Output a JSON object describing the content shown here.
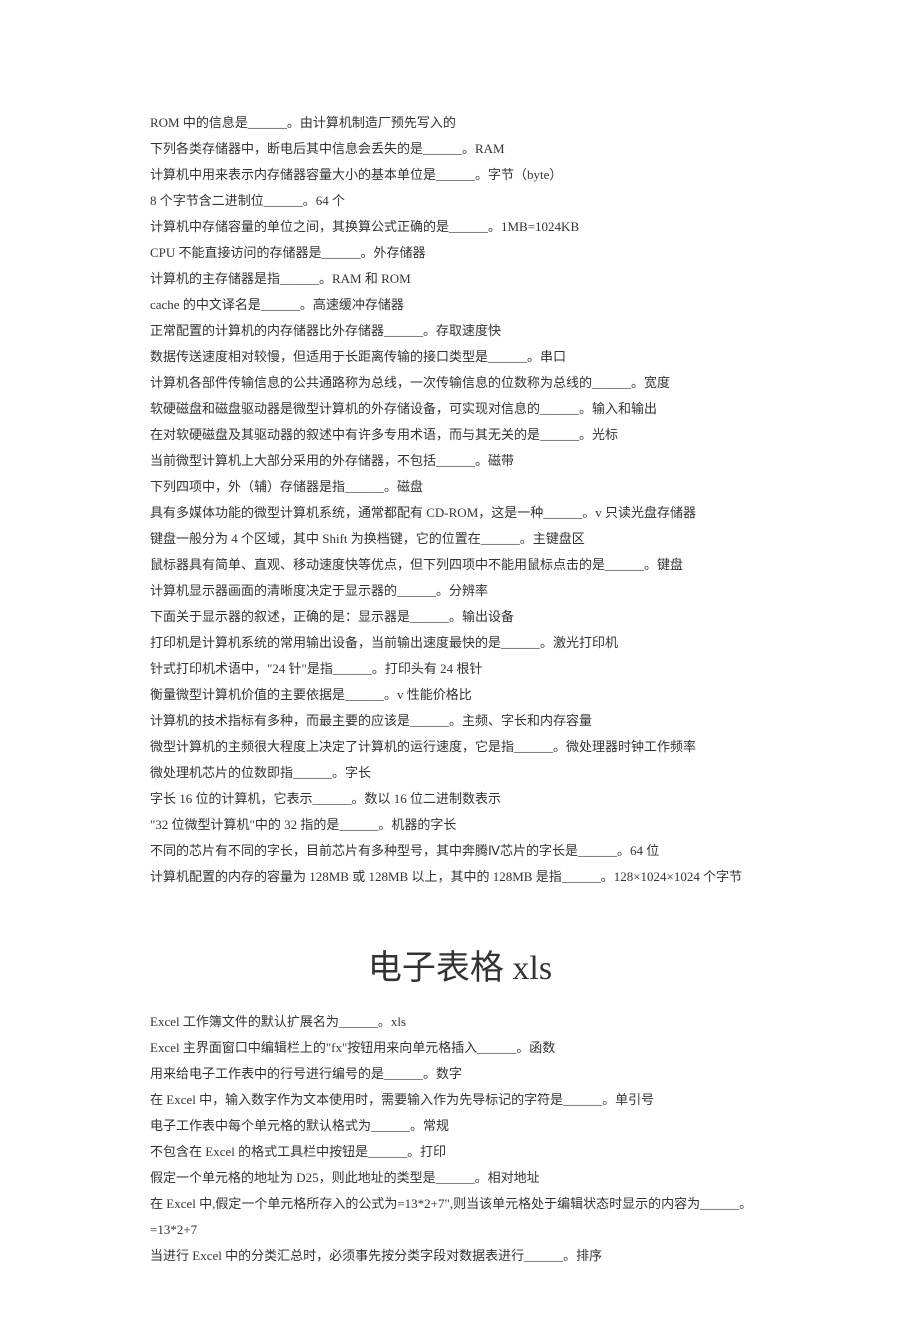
{
  "section1": {
    "lines": [
      "ROM 中的信息是______。由计算机制造厂预先写入的",
      "下列各类存储器中，断电后其中信息会丢失的是______。RAM",
      "计算机中用来表示内存储器容量大小的基本单位是______。字节（byte）",
      "8 个字节含二进制位______。64 个",
      "计算机中存储容量的单位之间，其换算公式正确的是______。1MB=1024KB",
      "CPU 不能直接访问的存储器是______。外存储器",
      "计算机的主存储器是指______。RAM 和 ROM",
      "cache 的中文译名是______。高速缓冲存储器",
      "正常配置的计算机的内存储器比外存储器______。存取速度快",
      "数据传送速度相对较慢，但适用于长距离传输的接口类型是______。串口",
      "计算机各部件传输信息的公共通路称为总线，一次传输信息的位数称为总线的______。宽度",
      "软硬磁盘和磁盘驱动器是微型计算机的外存储设备，可实现对信息的______。输入和输出",
      "在对软硬磁盘及其驱动器的叙述中有许多专用术语，而与其无关的是______。光标",
      "当前微型计算机上大部分采用的外存储器，不包括______。磁带",
      "下列四项中，外（辅）存储器是指______。磁盘",
      "具有多媒体功能的微型计算机系统，通常都配有 CD-ROM，这是一种______。v 只读光盘存储器",
      "键盘一般分为 4 个区域，其中 Shift 为换档键，它的位置在______。主键盘区",
      "鼠标器具有简单、直观、移动速度快等优点，但下列四项中不能用鼠标点击的是______。键盘",
      "计算机显示器画面的清晰度决定于显示器的______。分辨率",
      "下面关于显示器的叙述，正确的是：显示器是______。输出设备",
      "打印机是计算机系统的常用输出设备，当前输出速度最快的是______。激光打印机",
      "针式打印机术语中，\"24 针\"是指______。打印头有 24 根针",
      "衡量微型计算机价值的主要依据是______。v 性能价格比",
      "计算机的技术指标有多种，而最主要的应该是______。主频、字长和内存容量",
      "微型计算机的主频很大程度上决定了计算机的运行速度，它是指______。微处理器时钟工作频率",
      "微处理机芯片的位数即指______。字长",
      "字长 16 位的计算机，它表示______。数以 16 位二进制数表示",
      "\"32 位微型计算机\"中的 32 指的是______。机器的字长",
      "不同的芯片有不同的字长，目前芯片有多种型号，其中奔腾Ⅳ芯片的字长是______。64 位",
      "计算机配置的内存的容量为 128MB 或 128MB 以上，其中的 128MB 是指______。128×1024×1024 个字节"
    ]
  },
  "section2": {
    "heading": "电子表格 xls",
    "lines": [
      "Excel 工作簿文件的默认扩展名为______。xls",
      "Excel 主界面窗口中编辑栏上的\"fx\"按钮用来向单元格插入______。函数",
      "用来给电子工作表中的行号进行编号的是______。数字",
      "在 Excel 中，输入数字作为文本使用时，需要输入作为先导标记的字符是______。单引号",
      "电子工作表中每个单元格的默认格式为______。常规",
      "不包含在 Excel 的格式工具栏中按钮是______。打印",
      "假定一个单元格的地址为 D25，则此地址的类型是______。相对地址",
      "在 Excel 中,假定一个单元格所存入的公式为=13*2+7\",则当该单元格处于编辑状态时显示的内容为______。",
      "=13*2+7",
      "当进行 Excel 中的分类汇总时，必须事先按分类字段对数据表进行______。排序"
    ]
  }
}
